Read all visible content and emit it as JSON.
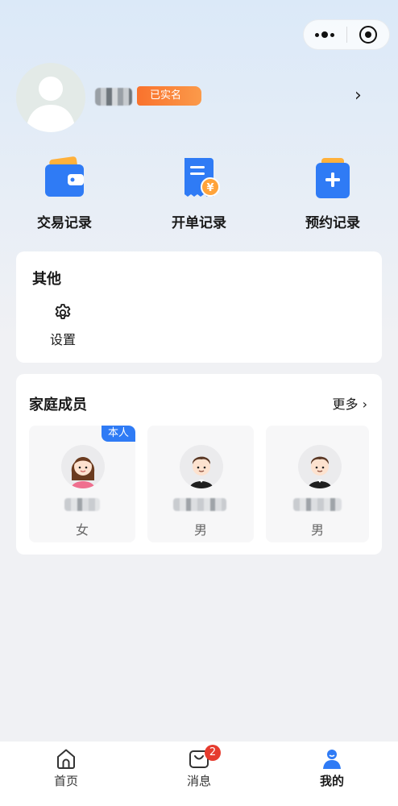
{
  "colors": {
    "accent_blue": "#2f7bf5",
    "badge_orange": "#f9722d",
    "badge_red": "#e63b2e"
  },
  "capsule": {
    "menu_icon": "more-dots-icon",
    "close_icon": "target-icon"
  },
  "profile": {
    "avatar_icon": "default-avatar-icon",
    "name": "███",
    "verified_label": "已实名",
    "chevron": "›"
  },
  "actions": [
    {
      "label": "交易记录",
      "icon": "wallet-icon"
    },
    {
      "label": "开单记录",
      "icon": "bill-icon"
    },
    {
      "label": "预约记录",
      "icon": "appointment-icon"
    }
  ],
  "other": {
    "title": "其他",
    "items": [
      {
        "label": "设置",
        "icon": "gear-icon"
      }
    ]
  },
  "family": {
    "title": "家庭成员",
    "more_label": "更多 ›",
    "members": [
      {
        "tag": "本人",
        "name": "███",
        "gender": "女",
        "icon": "female-avatar-icon"
      },
      {
        "tag": "",
        "name": "████",
        "gender": "男",
        "icon": "male-avatar-icon"
      },
      {
        "tag": "",
        "name": "████",
        "gender": "男",
        "icon": "male-avatar-icon"
      }
    ]
  },
  "tabbar": {
    "tabs": [
      {
        "label": "首页",
        "icon": "home-icon",
        "active": false
      },
      {
        "label": "消息",
        "icon": "message-bag-icon",
        "active": false,
        "badge": "2"
      },
      {
        "label": "我的",
        "icon": "person-icon",
        "active": true
      }
    ]
  }
}
